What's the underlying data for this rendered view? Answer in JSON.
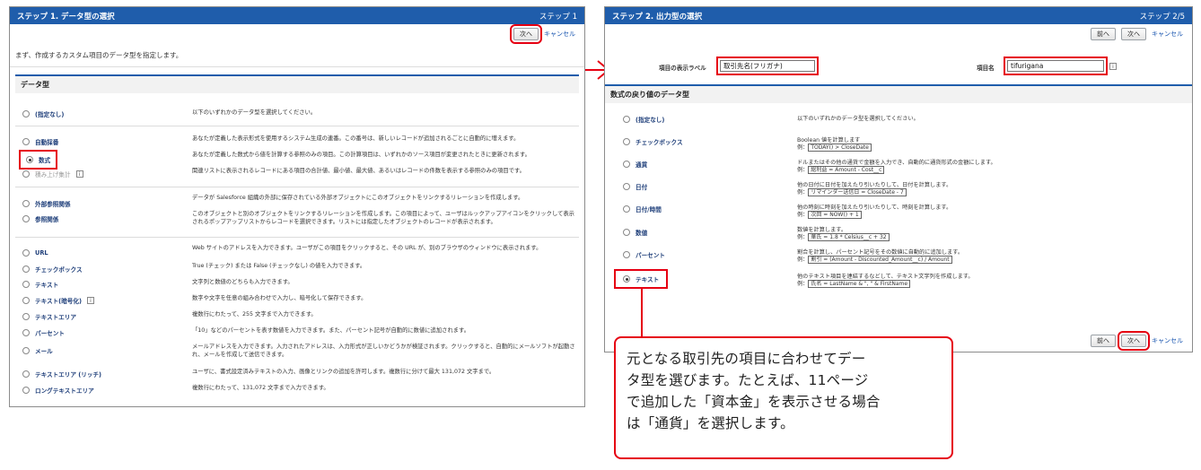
{
  "left": {
    "title": "ステップ 1. データ型の選択",
    "step": "ステップ 1",
    "next": "次へ",
    "cancel": "キャンセル",
    "instruction": "まず、作成するカスタム項目のデータ型を指定します。",
    "section": "データ型",
    "options": [
      {
        "label": "(指定なし)",
        "desc": "以下のいずれかのデータ型を選択してください。"
      },
      {
        "label": "自動採番",
        "desc": "あなたが定義した表示形式を使用するシステム生成の連番。この番号は、新しいレコードが追加されるごとに自動的に増えます。"
      },
      {
        "label": "数式",
        "desc": "あなたが定義した数式から値を計算する参照のみの項目。この計算項目は、いずれかのソース項目が変更されたときに更新されます。"
      },
      {
        "label": "積み上げ集計",
        "desc": "関連リストに表示されるレコードにある項目の合計値、最小値、最大値、あるいはレコードの件数を表示する参照のみの項目です。"
      },
      {
        "label": "外部参照関係",
        "desc": "データが Salesforce 組織の外部に保存されている外部オブジェクトにこのオブジェクトをリンクするリレーションを作成します。"
      },
      {
        "label": "参照関係",
        "desc": "このオブジェクトと別のオブジェクトをリンクするリレーションを作成します。この項目によって、ユーザはルックアップアイコンをクリックして表示されるポップアップリストからレコードを選択できます。リストには指定したオブジェクトのレコードが表示されます。"
      },
      {
        "label": "URL",
        "desc": "Web サイトのアドレスを入力できます。ユーザがこの項目をクリックすると、その URL が、別のブラウザのウィンドウに表示されます。"
      },
      {
        "label": "チェックボックス",
        "desc": "True (チェック) または False (チェックなし) の値を入力できます。"
      },
      {
        "label": "テキスト",
        "desc": "文字列と数値のどちらも入力できます。"
      },
      {
        "label": "テキスト(暗号化)",
        "desc": "数字や文字を任意の組み合わせで入力し、暗号化して保存できます。"
      },
      {
        "label": "テキストエリア",
        "desc": "複数行にわたって、255 文字まで入力できます。"
      },
      {
        "label": "パーセント",
        "desc": "「10」などのパーセントを表す数値を入力できます。また、パーセント記号が自動的に数値に追加されます。"
      },
      {
        "label": "メール",
        "desc": "メールアドレスを入力できます。入力されたアドレスは、入力形式が正しいかどうかが検証されます。クリックすると、自動的にメールソフトが起動され、メールを作成して送信できます。"
      },
      {
        "label": "テキストエリア (リッチ)",
        "desc": "ユーザに、書式設定済みテキストの入力、画像とリンクの追加を許可します。複数行に分けて最大 131,072 文字まで。"
      },
      {
        "label": "ロングテキストエリア",
        "desc": "複数行にわたって、131,072 文字まで入力できます。"
      }
    ],
    "info_badge": "i"
  },
  "right": {
    "title": "ステップ 2. 出力型の選択",
    "step": "ステップ 2/5",
    "prev": "前へ",
    "next": "次へ",
    "cancel": "キャンセル",
    "label_caption": "項目の表示ラベル",
    "label_value": "取引先名(フリガナ)",
    "name_caption": "項目名",
    "name_value": "tifurigana",
    "info_badge": "i",
    "section": "数式の戻り値のデータ型",
    "options": [
      {
        "label": "(指定なし)",
        "desc": "以下のいずれかのデータ型を選択してください。",
        "example": ""
      },
      {
        "label": "チェックボックス",
        "desc": "Boolean 値を計算します",
        "example": "TODAY() > CloseDate"
      },
      {
        "label": "通貨",
        "desc": "ドルまたはその他の通貨で金額を入力でき、自動的に通貨形式の金額にします。",
        "example": "総利益 = Amount - Cost__c"
      },
      {
        "label": "日付",
        "desc": "他の日付に日付を加えたり引いたりして、日付を計算します。",
        "example": "リマインダー送信日 = CloseDate - 7"
      },
      {
        "label": "日付/時間",
        "desc": "他の時刻に時刻を加えたり引いたりして、時刻を計算します。",
        "example": "次回 = NOW() + 1"
      },
      {
        "label": "数値",
        "desc": "数値を計算します。",
        "example": "華氏 = 1.8 * Celsius__c + 32"
      },
      {
        "label": "パーセント",
        "desc": "割合を計算し、パーセント記号をその数値に自動的に追加します。",
        "example": "割引 = (Amount - Discounted_Amount__c) / Amount"
      },
      {
        "label": "テキスト",
        "desc": "他のテキスト項目を連結するなどして、テキスト文字列を作成します。",
        "example": "氏名 = LastName & \", \" & FirstName"
      }
    ],
    "example_prefix": "例："
  },
  "callout": {
    "line1": "元となる取引先の項目に合わせてデー",
    "line2": "タ型を選びます。たとえば、11ページ",
    "line3": "で追加した「資本金」を表示させる場合",
    "line4": "は「通貨」を選択します。"
  },
  "colors": {
    "accent": "#1f5dab",
    "highlight": "#e60012"
  }
}
